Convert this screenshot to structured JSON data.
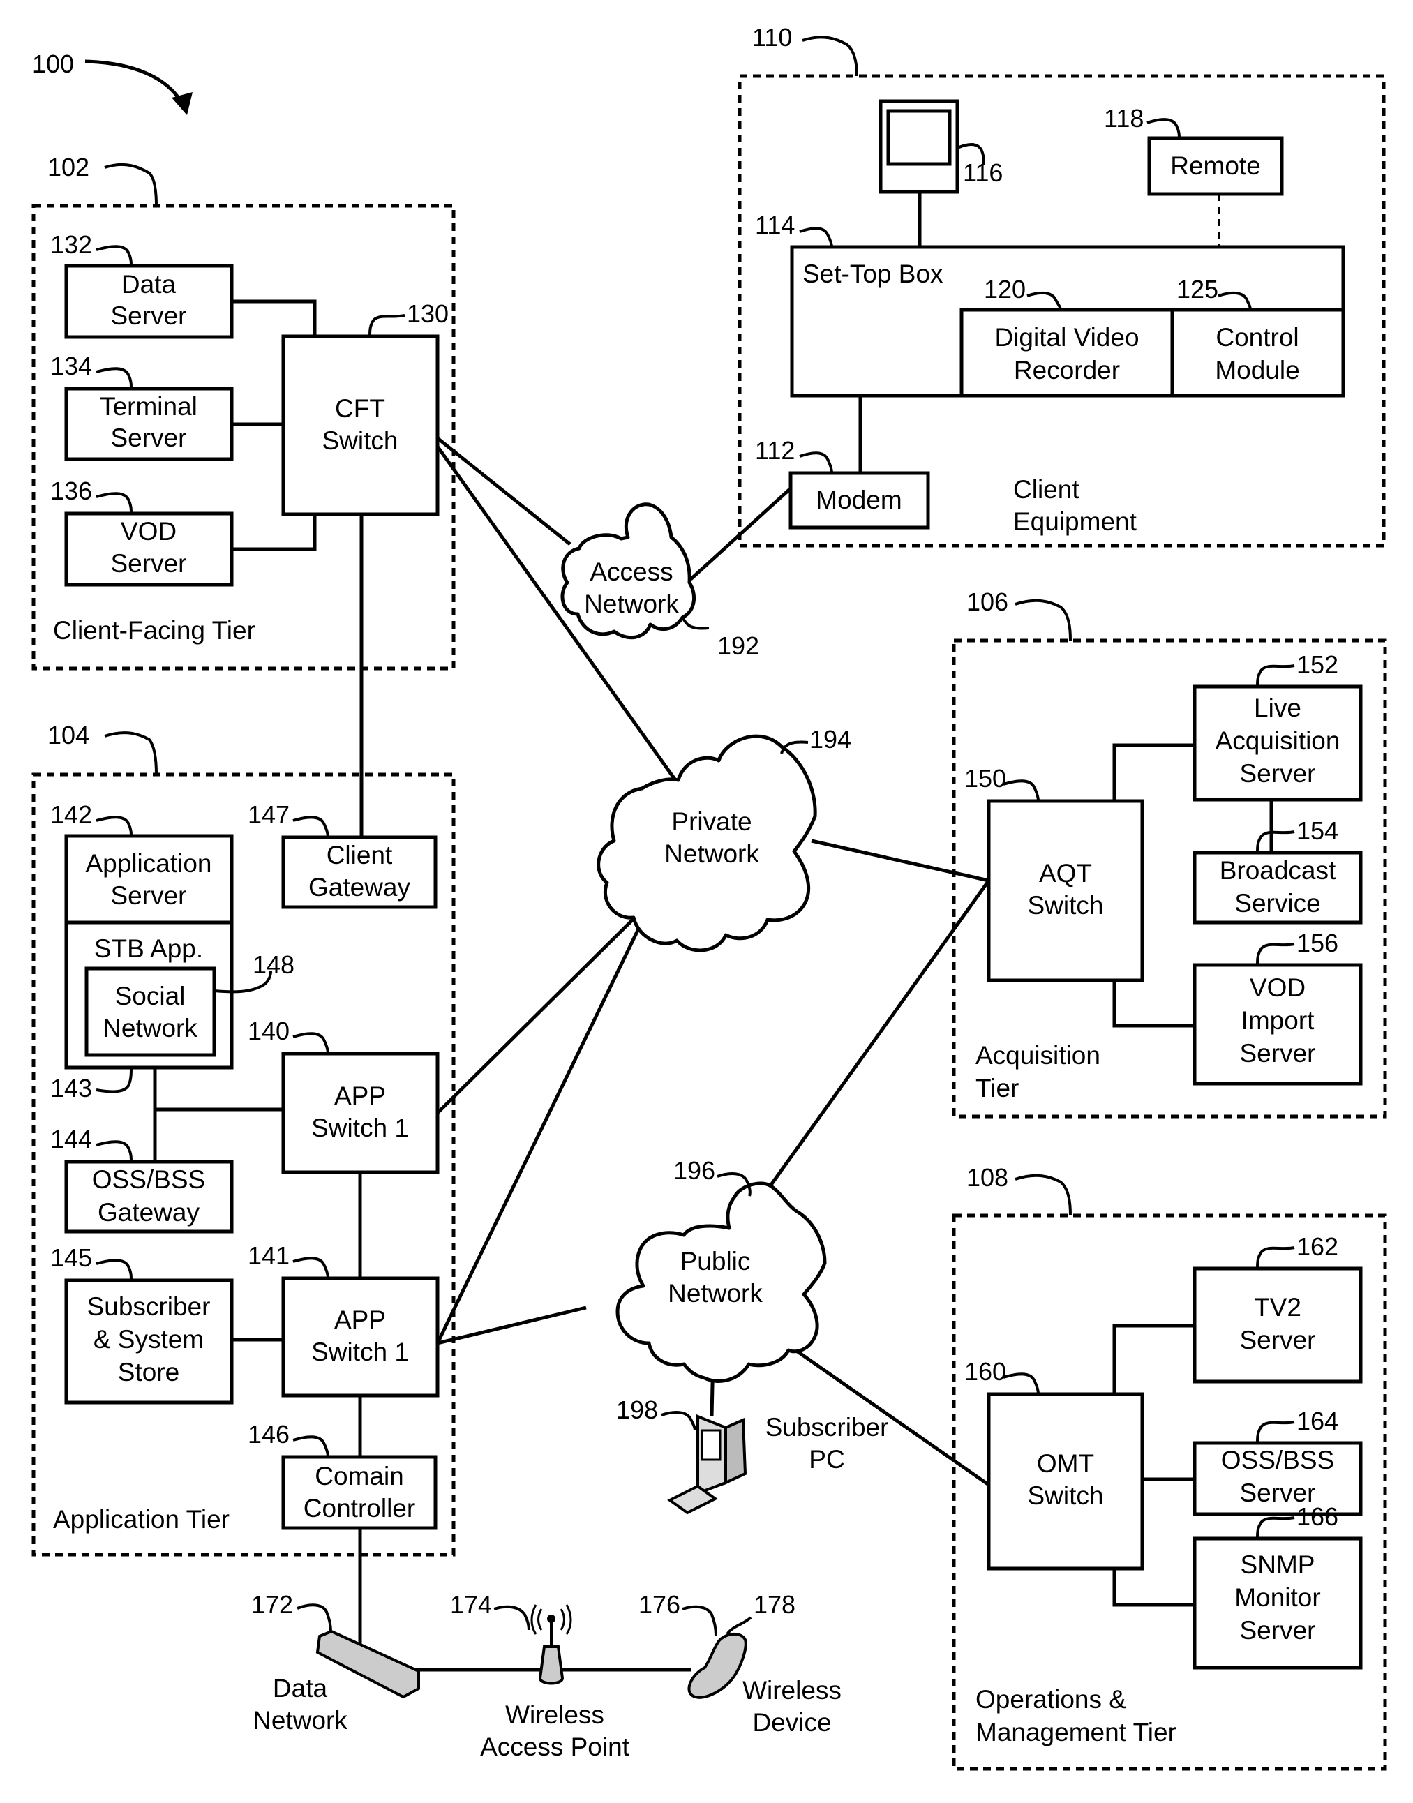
{
  "figure": {
    "ref": "100",
    "colors": {
      "ink": "#000000",
      "background": "#ffffff"
    }
  },
  "tiers": {
    "client_facing": {
      "ref": "102",
      "label": "Client-Facing Tier"
    },
    "application": {
      "ref": "104",
      "label": "Application Tier"
    },
    "acquisition": {
      "ref": "106",
      "label_lines": [
        "Acquisition",
        "Tier"
      ]
    },
    "operations": {
      "ref": "108",
      "label_lines": [
        "Operations &",
        "Management Tier"
      ]
    },
    "client_equipment": {
      "ref": "110",
      "label_lines": [
        "Client",
        "Equipment"
      ]
    }
  },
  "nodes": {
    "data_server": {
      "ref": "132",
      "lines": [
        "Data",
        "Server"
      ]
    },
    "terminal_server": {
      "ref": "134",
      "lines": [
        "Terminal",
        "Server"
      ]
    },
    "vod_server": {
      "ref": "136",
      "lines": [
        "VOD",
        "Server"
      ]
    },
    "cft_switch": {
      "ref": "130",
      "lines": [
        "CFT",
        "Switch"
      ]
    },
    "modem": {
      "ref": "112",
      "lines": [
        "Modem"
      ]
    },
    "set_top_box": {
      "ref": "114",
      "lines": [
        "Set-Top Box"
      ]
    },
    "display": {
      "ref": "116"
    },
    "remote": {
      "ref": "118",
      "lines": [
        "Remote"
      ]
    },
    "dvr": {
      "ref": "120",
      "lines": [
        "Digital Video",
        "Recorder"
      ]
    },
    "control_module": {
      "ref": "125",
      "lines": [
        "Control",
        "Module"
      ]
    },
    "application_server": {
      "ref": "142",
      "lines": [
        "Application",
        "Server"
      ]
    },
    "stb_app": {
      "ref": "143",
      "lines": [
        "STB App."
      ]
    },
    "social_network": {
      "ref": "148",
      "lines": [
        "Social",
        "Network"
      ]
    },
    "client_gateway": {
      "ref": "147",
      "lines": [
        "Client",
        "Gateway"
      ]
    },
    "app_switch_a": {
      "ref": "140",
      "lines": [
        "APP",
        "Switch 1"
      ]
    },
    "oss_bss_gateway": {
      "ref": "144",
      "lines": [
        "OSS/BSS",
        "Gateway"
      ]
    },
    "subscriber_store": {
      "ref": "145",
      "lines": [
        "Subscriber",
        "& System",
        "Store"
      ]
    },
    "app_switch_b": {
      "ref": "141",
      "lines": [
        "APP",
        "Switch 1"
      ]
    },
    "domain_controller": {
      "ref": "146",
      "lines": [
        "Comain",
        "Controller"
      ]
    },
    "aqt_switch": {
      "ref": "150",
      "lines": [
        "AQT",
        "Switch"
      ]
    },
    "live_acquisition_server": {
      "ref": "152",
      "lines": [
        "Live",
        "Acquisition",
        "Server"
      ]
    },
    "broadcast_service": {
      "ref": "154",
      "lines": [
        "Broadcast",
        "Service"
      ]
    },
    "vod_import_server": {
      "ref": "156",
      "lines": [
        "VOD",
        "Import",
        "Server"
      ]
    },
    "omt_switch": {
      "ref": "160",
      "lines": [
        "OMT",
        "Switch"
      ]
    },
    "tv2_server": {
      "ref": "162",
      "lines": [
        "TV2",
        "Server"
      ]
    },
    "oss_bss_server": {
      "ref": "164",
      "lines": [
        "OSS/BSS",
        "Server"
      ]
    },
    "snmp_monitor_server": {
      "ref": "166",
      "lines": [
        "SNMP",
        "Monitor",
        "Server"
      ]
    }
  },
  "networks": {
    "access": {
      "ref": "192",
      "lines": [
        "Access",
        "Network"
      ]
    },
    "private": {
      "ref": "194",
      "lines": [
        "Private",
        "Network"
      ]
    },
    "public": {
      "ref": "196",
      "lines": [
        "Public",
        "Network"
      ]
    }
  },
  "devices": {
    "subscriber_pc": {
      "ref": "198",
      "lines": [
        "Subscriber",
        "PC"
      ]
    },
    "data_network": {
      "ref": "172",
      "lines": [
        "Data",
        "Network"
      ]
    },
    "wireless_access_point": {
      "ref": "174",
      "lines": [
        "Wireless",
        "Access Point"
      ]
    },
    "wireless_device": {
      "ref": "176",
      "ref2": "178",
      "lines": [
        "Wireless",
        "Device"
      ]
    }
  }
}
